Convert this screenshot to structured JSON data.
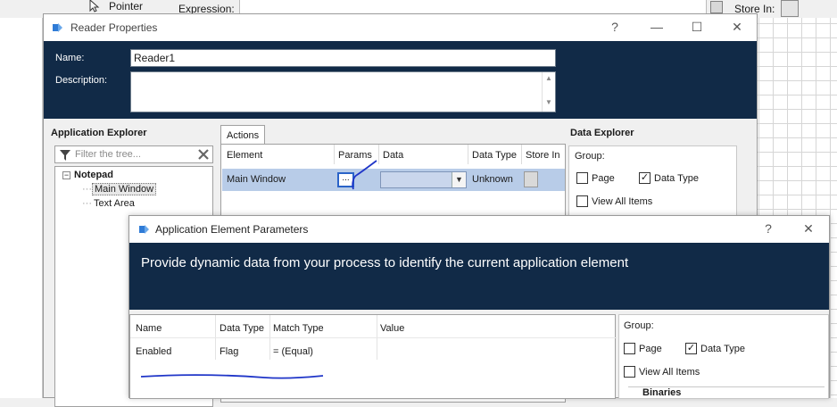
{
  "background": {
    "toolbar_pointer": "Pointer",
    "expression_label": "Expression:",
    "store_in_label": "Store In:"
  },
  "reader_window": {
    "title": "Reader Properties",
    "controls": {
      "help": "?",
      "minimize": "—",
      "maximize": "☐",
      "close": "✕"
    },
    "name_label": "Name:",
    "name_value": "Reader1",
    "description_label": "Description:",
    "description_value": "",
    "app_explorer": {
      "title": "Application Explorer",
      "filter_placeholder": "Filter the tree...",
      "tree": {
        "root": "Notepad",
        "children": [
          "Main Window",
          "Text Area"
        ]
      }
    },
    "actions": {
      "tab_label": "Actions",
      "columns": [
        "Element",
        "Params",
        "Data",
        "Data Type",
        "Store In"
      ],
      "rows": [
        {
          "element": "Main Window",
          "params": "...",
          "data": "",
          "data_type": "Unknown"
        }
      ]
    },
    "data_explorer": {
      "title": "Data Explorer",
      "group_label": "Group:",
      "page_label": "Page",
      "page_checked": false,
      "data_type_label": "Data Type",
      "data_type_checked": true,
      "view_all_label": "View All Items",
      "view_all_checked": false
    }
  },
  "params_window": {
    "title": "Application Element Parameters",
    "controls": {
      "help": "?",
      "close": "✕"
    },
    "description": "Provide dynamic data from your process to identify the current application element",
    "columns": [
      "Name",
      "Data Type",
      "Match Type",
      "Value"
    ],
    "rows": [
      {
        "name": "Enabled",
        "data_type": "Flag",
        "match_type": "=  (Equal)",
        "value": ""
      }
    ],
    "data_explorer": {
      "group_label": "Group:",
      "page_label": "Page",
      "page_checked": false,
      "data_type_label": "Data Type",
      "data_type_checked": true,
      "view_all_label": "View All Items",
      "view_all_checked": false,
      "tree_item": "Binaries"
    }
  },
  "colors": {
    "header_navy": "#112a47",
    "selected_row": "#b8cce8",
    "annotation_ink": "#1f35c8"
  }
}
